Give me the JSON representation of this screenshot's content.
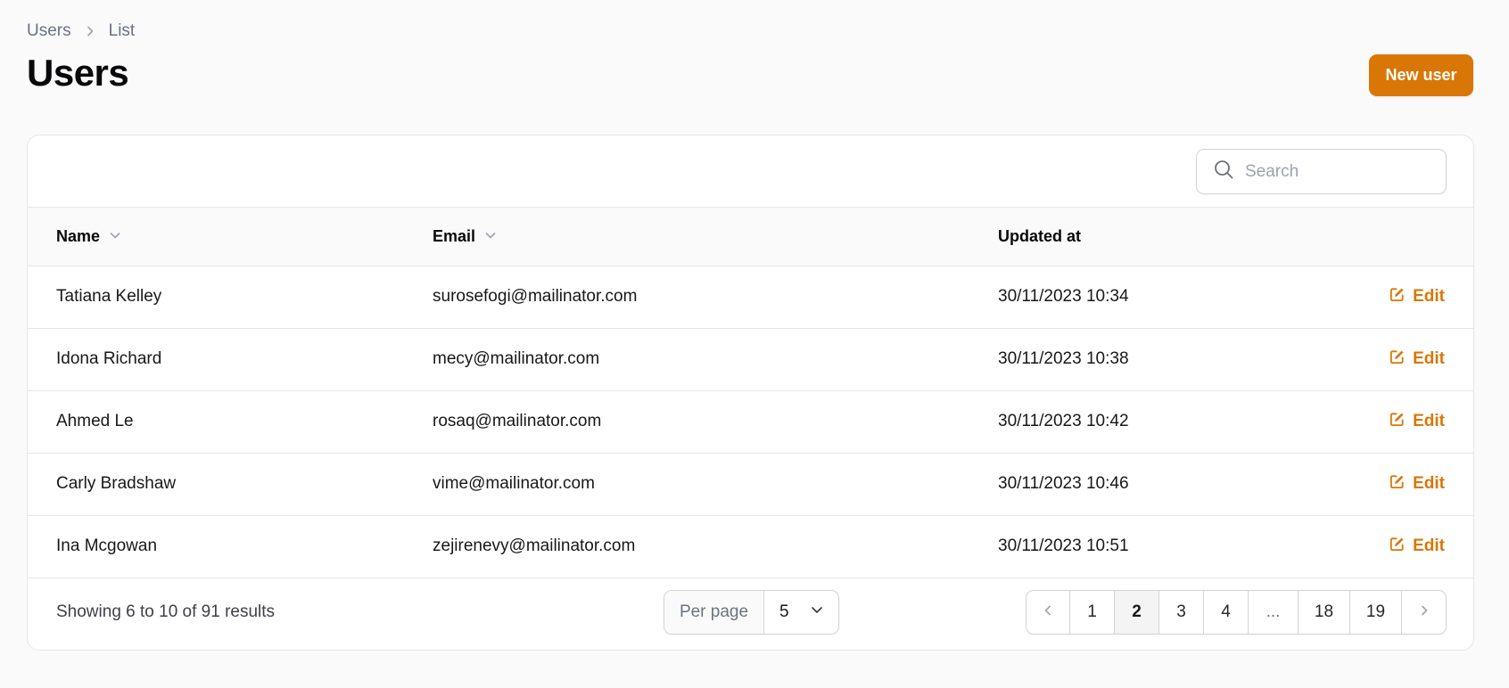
{
  "breadcrumb": {
    "root": "Users",
    "current": "List"
  },
  "page": {
    "title": "Users",
    "new_button": "New user"
  },
  "search": {
    "placeholder": "Search"
  },
  "table": {
    "columns": {
      "name": "Name",
      "email": "Email",
      "updated": "Updated at"
    },
    "edit_label": "Edit",
    "rows": [
      {
        "name": "Tatiana Kelley",
        "email": "surosefogi@mailinator.com",
        "updated": "30/11/2023 10:34"
      },
      {
        "name": "Idona Richard",
        "email": "mecy@mailinator.com",
        "updated": "30/11/2023 10:38"
      },
      {
        "name": "Ahmed Le",
        "email": "rosaq@mailinator.com",
        "updated": "30/11/2023 10:42"
      },
      {
        "name": "Carly Bradshaw",
        "email": "vime@mailinator.com",
        "updated": "30/11/2023 10:46"
      },
      {
        "name": "Ina Mcgowan",
        "email": "zejirenevy@mailinator.com",
        "updated": "30/11/2023 10:51"
      }
    ]
  },
  "footer": {
    "results": "Showing 6 to 10 of 91 results",
    "per_page_label": "Per page",
    "per_page_value": "5",
    "pages": [
      "1",
      "2",
      "3",
      "4",
      "...",
      "18",
      "19"
    ],
    "current_page": "2"
  },
  "colors": {
    "accent": "#d97706",
    "border": "#e6e6e8",
    "background": "#fafafa"
  },
  "icons": {
    "breadcrumb_separator": "chevron-right-icon",
    "search": "search-icon",
    "sort": "chevron-down-icon",
    "edit": "pencil-square-icon",
    "prev": "chevron-left-icon",
    "next": "chevron-right-icon"
  }
}
